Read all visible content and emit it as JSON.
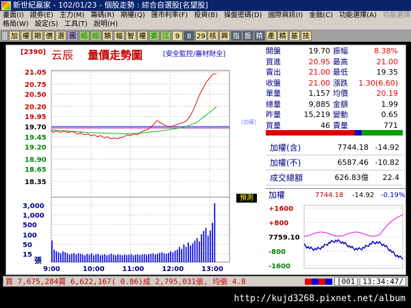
{
  "window": {
    "title": "新世紀贏家 - 102/01/23 - 個股走勢 : 綜合自選股[名望股]"
  },
  "menu": {
    "row1": [
      "畫面(I)",
      "證券(E)",
      "主力(M)",
      "籌碼(R)",
      "期權(Q)",
      "匯市利率(F)",
      "投資(B)",
      "操盤密碼(D)",
      "國際資訊(I)",
      "金融(C)",
      "功能選擇(A)"
    ],
    "row1_disabled": "功能選擇(B)",
    "row2": [
      "格局(W)",
      "設定(S)",
      "工具(T)",
      "說明(H)"
    ]
  },
  "toolbar": {
    "buttons": [
      "加",
      "權",
      "期",
      "價",
      "選",
      "圖",
      "綜",
      "綜",
      "類",
      "幅",
      "智",
      "權",
      "委",
      "江",
      "9",
      "8",
      "29",
      "核",
      "興",
      "指",
      "盤",
      "精",
      "產",
      "精",
      "基",
      "技"
    ]
  },
  "chart": {
    "code": "[2390]",
    "name": "云辰",
    "title": "量價走勢圖",
    "subtitle": "[安全監控/審材財全]",
    "index_tag": "(加權)",
    "yuce_label": "預測",
    "volume_unit": "張"
  },
  "chart_data": {
    "type": "line",
    "price_ticks": [
      "21.05",
      "20.75",
      "20.50",
      "20.20",
      "19.95",
      "19.70",
      "19.45",
      "19.20",
      "18.90",
      "18.65",
      "18.35"
    ],
    "ylim": [
      18.35,
      21.05
    ],
    "reference_price": 19.7,
    "volume_ticks": [
      "3,000",
      "1,000",
      "500",
      "100",
      "50",
      "15"
    ],
    "time_ticks": [
      "9:00",
      "10:00",
      "11:00",
      "12:00",
      "13:00"
    ],
    "price_series": [
      {
        "t": 0,
        "v": 19.62
      },
      {
        "t": 3,
        "v": 19.55
      },
      {
        "t": 6,
        "v": 19.6
      },
      {
        "t": 10,
        "v": 19.58
      },
      {
        "t": 15,
        "v": 19.56
      },
      {
        "t": 20,
        "v": 19.6
      },
      {
        "t": 25,
        "v": 19.55
      },
      {
        "t": 30,
        "v": 19.58
      },
      {
        "t": 35,
        "v": 19.56
      },
      {
        "t": 40,
        "v": 19.52
      },
      {
        "t": 45,
        "v": 19.55
      },
      {
        "t": 50,
        "v": 19.5
      },
      {
        "t": 55,
        "v": 19.52
      },
      {
        "t": 60,
        "v": 19.48
      },
      {
        "t": 65,
        "v": 19.5
      },
      {
        "t": 70,
        "v": 19.45
      },
      {
        "t": 75,
        "v": 19.48
      },
      {
        "t": 80,
        "v": 19.42
      },
      {
        "t": 85,
        "v": 19.45
      },
      {
        "t": 90,
        "v": 19.4
      },
      {
        "t": 95,
        "v": 19.42
      },
      {
        "t": 100,
        "v": 19.4
      },
      {
        "t": 105,
        "v": 19.43
      },
      {
        "t": 110,
        "v": 19.45
      },
      {
        "t": 115,
        "v": 19.5
      },
      {
        "t": 120,
        "v": 19.48
      },
      {
        "t": 125,
        "v": 19.52
      },
      {
        "t": 130,
        "v": 19.5
      },
      {
        "t": 135,
        "v": 19.55
      },
      {
        "t": 140,
        "v": 19.6
      },
      {
        "t": 145,
        "v": 19.62
      },
      {
        "t": 150,
        "v": 19.68
      },
      {
        "t": 155,
        "v": 19.75
      },
      {
        "t": 160,
        "v": 19.85
      },
      {
        "t": 165,
        "v": 19.8
      },
      {
        "t": 170,
        "v": 19.75
      },
      {
        "t": 175,
        "v": 19.72
      },
      {
        "t": 180,
        "v": 19.7
      },
      {
        "t": 185,
        "v": 19.72
      },
      {
        "t": 190,
        "v": 19.75
      },
      {
        "t": 195,
        "v": 19.78
      },
      {
        "t": 200,
        "v": 19.8
      },
      {
        "t": 205,
        "v": 19.85
      },
      {
        "t": 210,
        "v": 19.95
      },
      {
        "t": 215,
        "v": 20.1
      },
      {
        "t": 220,
        "v": 20.3
      },
      {
        "t": 225,
        "v": 20.5
      },
      {
        "t": 230,
        "v": 20.65
      },
      {
        "t": 235,
        "v": 20.8
      },
      {
        "t": 240,
        "v": 20.9
      },
      {
        "t": 245,
        "v": 21.0
      },
      {
        "t": 250,
        "v": 21.0
      }
    ],
    "avg_series": [
      {
        "t": 0,
        "v": 19.62
      },
      {
        "t": 60,
        "v": 19.55
      },
      {
        "t": 120,
        "v": 19.52
      },
      {
        "t": 160,
        "v": 19.58
      },
      {
        "t": 200,
        "v": 19.68
      },
      {
        "t": 220,
        "v": 19.8
      },
      {
        "t": 240,
        "v": 20.05
      },
      {
        "t": 250,
        "v": 20.19
      }
    ],
    "volume_series": [
      120,
      40,
      30,
      25,
      20,
      30,
      25,
      20,
      15,
      18,
      22,
      15,
      20,
      18,
      15,
      12,
      18,
      15,
      20,
      12,
      15,
      18,
      12,
      14,
      16,
      12,
      15,
      18,
      14,
      12,
      16,
      14,
      12,
      15,
      13,
      14,
      16,
      12,
      14,
      15,
      13,
      15,
      17,
      14,
      16,
      18,
      20,
      15,
      18,
      22,
      25,
      20,
      18,
      22,
      30,
      25,
      35,
      40,
      60,
      45,
      80,
      60,
      100,
      70,
      90,
      120,
      150,
      110,
      200,
      250,
      300,
      180,
      260,
      400,
      900
    ]
  },
  "quote": {
    "rows": [
      {
        "l1": "開盤",
        "v1": "19.70",
        "c1": "black",
        "l2": "振幅",
        "v2": "8.38%",
        "c2": "red"
      },
      {
        "l1": "買進",
        "v1": "20.95",
        "c1": "red",
        "l2": "最高",
        "v2": "21.00",
        "c2": "red"
      },
      {
        "l1": "賣出",
        "v1": "21.00",
        "c1": "red",
        "l2": "最低",
        "v2": "19.35",
        "c2": "black"
      },
      {
        "l1": "收盤",
        "v1": "21.00",
        "c1": "red",
        "l2": "漲跌",
        "v2": "1.30(6.60)",
        "c2": "red"
      },
      {
        "l1": "單量",
        "v1": "1,157",
        "c1": "black",
        "l2": "均價",
        "v2": "20.19",
        "c2": "red"
      },
      {
        "l1": "總量",
        "v1": "9,885",
        "c1": "black",
        "l2": "金額",
        "v2": "1.99",
        "c2": "black"
      },
      {
        "l1": "昨量",
        "v1": "15,219",
        "c1": "black",
        "l2": "變動",
        "v2": "0.65",
        "c2": "black"
      },
      {
        "l1": "買量",
        "v1": "46",
        "c1": "black",
        "l2": "賣量",
        "v2": "771",
        "c2": "black"
      }
    ]
  },
  "index_panel": {
    "rows": [
      {
        "label": "加權(含)",
        "value": "7744.18",
        "change": "-14.92"
      },
      {
        "label": "加權(不)",
        "value": "6587.46",
        "change": "-10.82"
      },
      {
        "label": "成交總額",
        "value": "626.83億",
        "change": "22.4"
      }
    ]
  },
  "mini_chart": {
    "label": "加權",
    "value": "7744.18",
    "change": "-14.92",
    "pct": "-0.19%",
    "ticks": [
      "+1600",
      "+800",
      "7759.10",
      "-800",
      "-1600"
    ]
  },
  "status": {
    "text": "買 7,675,284賣 6,622,167( 0.86)成 2,795,031張, 均張 4.8",
    "box_code": "[001",
    "time": "13:34:47/"
  },
  "footer": {
    "url": "http://kujd3268.pixnet.net/album"
  },
  "colors": {
    "price_line": "#e00000",
    "avg_line": "#00c000",
    "ref_line": "#8080ff",
    "volume_bar": "#0000e0",
    "index_line": "#a000c0"
  }
}
